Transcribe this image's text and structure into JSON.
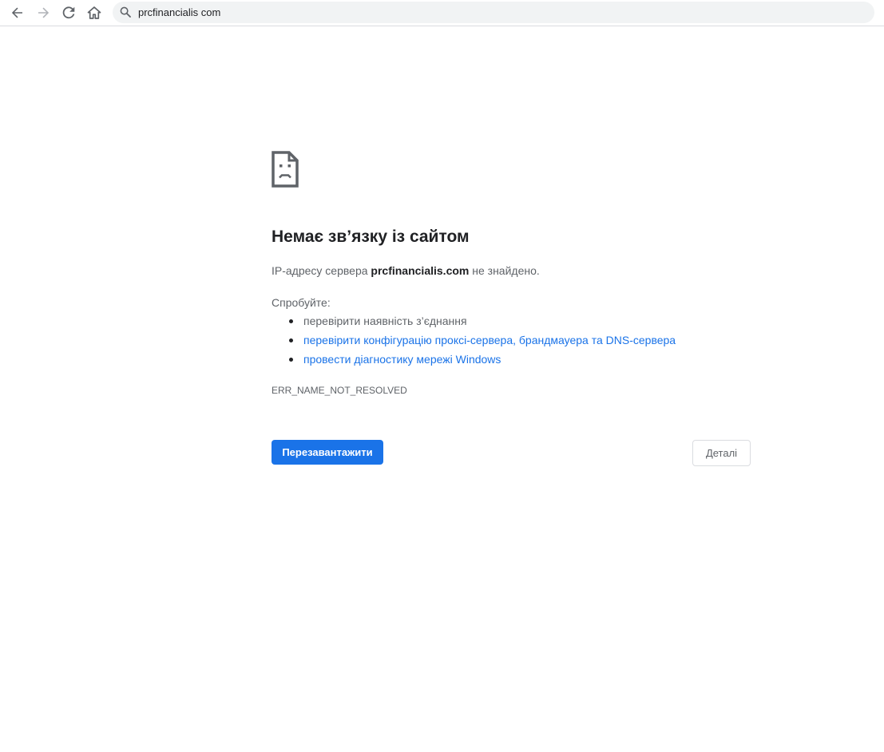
{
  "toolbar": {
    "back_icon": "arrow-left-icon",
    "forward_icon": "arrow-right-icon",
    "reload_icon": "reload-icon",
    "home_icon": "home-icon",
    "search_icon": "search-icon",
    "url": "prcfinancialis com"
  },
  "error_page": {
    "icon": "sad-page-icon",
    "title": "Немає зв’язку із сайтом",
    "desc_prefix": "IP-адресу сервера ",
    "desc_host": "prcfinancialis.com",
    "desc_suffix": " не знайдено.",
    "try_label": "Спробуйте:",
    "suggestions": [
      "перевірити наявність з’єднання",
      "перевірити конфігурацію проксі-сервера, брандмауера та DNS-сервера",
      "провести діагностику мережі Windows"
    ],
    "error_code": "ERR_NAME_NOT_RESOLVED",
    "reload_label": "Перезавантажити",
    "details_label": "Деталі"
  },
  "colors": {
    "accent": "#1a73e8",
    "text_primary": "#202124",
    "text_secondary": "#5f6368",
    "omnibox_bg": "#f1f3f4"
  }
}
